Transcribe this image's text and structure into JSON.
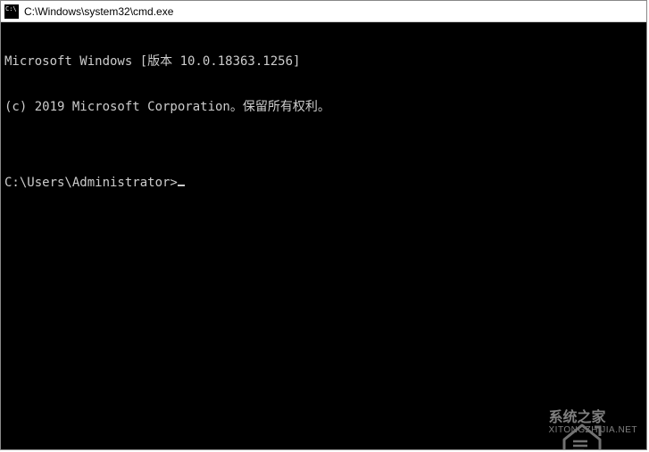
{
  "titlebar": {
    "title": "C:\\Windows\\system32\\cmd.exe"
  },
  "terminal": {
    "line1": "Microsoft Windows [版本 10.0.18363.1256]",
    "line2": "(c) 2019 Microsoft Corporation。保留所有权利。",
    "blank": "",
    "prompt": "C:\\Users\\Administrator>"
  },
  "watermark": {
    "name_cn": "系统之家",
    "url": "XITONGZHIJIA.NET"
  }
}
